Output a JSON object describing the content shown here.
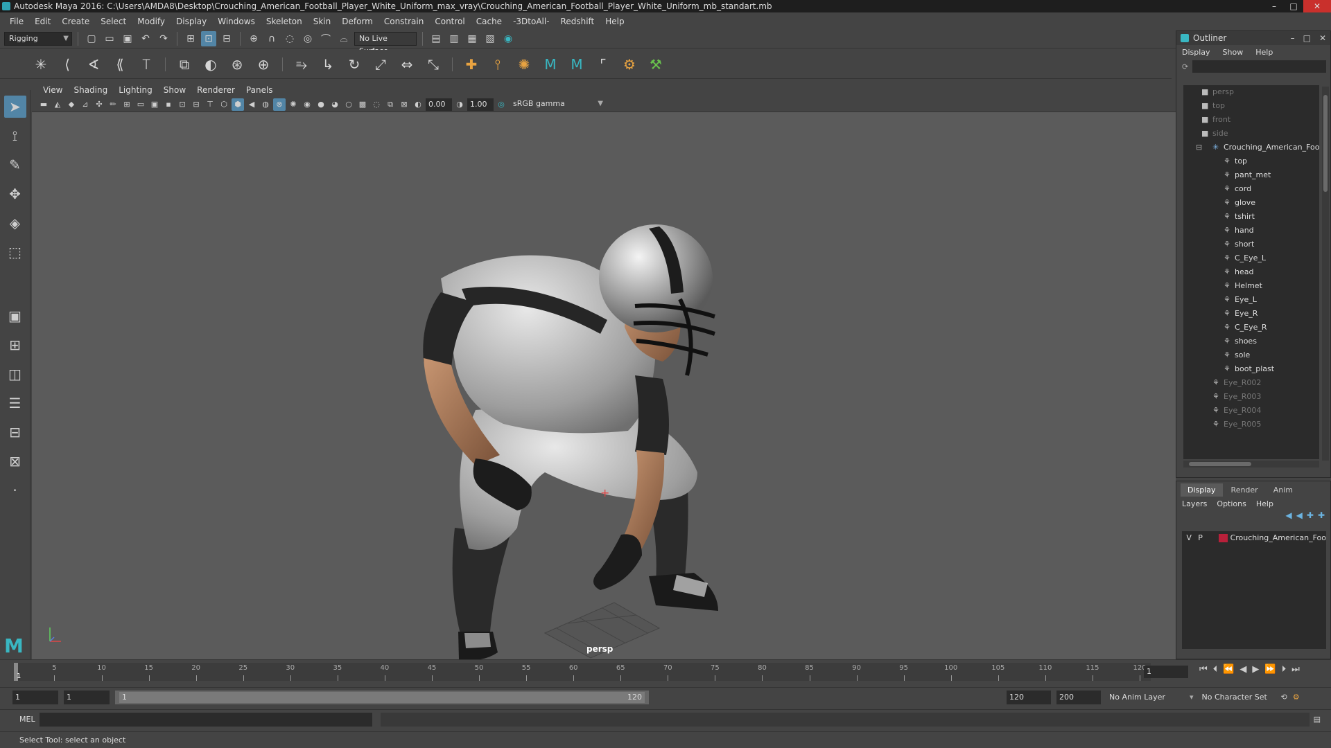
{
  "window": {
    "title": "Autodesk Maya 2016: C:\\Users\\AMDA8\\Desktop\\Crouching_American_Football_Player_White_Uniform_max_vray\\Crouching_American_Football_Player_White_Uniform_mb_standart.mb",
    "controls": {
      "minimize": "–",
      "maximize": "□",
      "close": "✕"
    }
  },
  "menubar": [
    "File",
    "Edit",
    "Create",
    "Select",
    "Modify",
    "Display",
    "Windows",
    "Skeleton",
    "Skin",
    "Deform",
    "Constrain",
    "Control",
    "Cache",
    "-3DtoAll-",
    "Redshift",
    "Help"
  ],
  "statusline": {
    "mode": "Rigging",
    "live_surface": "No Live Surface"
  },
  "viewport": {
    "menu": [
      "View",
      "Shading",
      "Lighting",
      "Show",
      "Renderer",
      "Panels"
    ],
    "exposure": "0.00",
    "gamma": "1.00",
    "color_space": "sRGB gamma",
    "camera_label": "persp"
  },
  "outliner": {
    "title": "Outliner",
    "title_buttons": {
      "minimize": "–",
      "maximize": "□",
      "close": "✕"
    },
    "menu": [
      "Display",
      "Show",
      "Help"
    ],
    "items": [
      {
        "label": "persp",
        "type": "camera",
        "dim": true
      },
      {
        "label": "top",
        "type": "camera",
        "dim": true
      },
      {
        "label": "front",
        "type": "camera",
        "dim": true
      },
      {
        "label": "side",
        "type": "camera",
        "dim": true
      },
      {
        "label": "Crouching_American_Foo",
        "type": "group",
        "dim": false
      },
      {
        "label": "top",
        "type": "mesh",
        "dim": false
      },
      {
        "label": "pant_met",
        "type": "mesh",
        "dim": false
      },
      {
        "label": "cord",
        "type": "mesh",
        "dim": false
      },
      {
        "label": "glove",
        "type": "mesh",
        "dim": false
      },
      {
        "label": "tshirt",
        "type": "mesh",
        "dim": false
      },
      {
        "label": "hand",
        "type": "mesh",
        "dim": false
      },
      {
        "label": "short",
        "type": "mesh",
        "dim": false
      },
      {
        "label": "C_Eye_L",
        "type": "mesh",
        "dim": false
      },
      {
        "label": "head",
        "type": "mesh",
        "dim": false
      },
      {
        "label": "Helmet",
        "type": "mesh",
        "dim": false
      },
      {
        "label": "Eye_L",
        "type": "mesh",
        "dim": false
      },
      {
        "label": "Eye_R",
        "type": "mesh",
        "dim": false
      },
      {
        "label": "C_Eye_R",
        "type": "mesh",
        "dim": false
      },
      {
        "label": "shoes",
        "type": "mesh",
        "dim": false
      },
      {
        "label": "sole",
        "type": "mesh",
        "dim": false
      },
      {
        "label": "boot_plast",
        "type": "mesh",
        "dim": false
      },
      {
        "label": "Eye_R002",
        "type": "mesh",
        "dim": true
      },
      {
        "label": "Eye_R003",
        "type": "mesh",
        "dim": true
      },
      {
        "label": "Eye_R004",
        "type": "mesh",
        "dim": true
      },
      {
        "label": "Eye_R005",
        "type": "mesh",
        "dim": true
      }
    ]
  },
  "layers": {
    "tabs": [
      "Display",
      "Render",
      "Anim"
    ],
    "menu": [
      "Layers",
      "Options",
      "Help"
    ],
    "rows": [
      {
        "v": "V",
        "p": "P",
        "name": "Crouching_American_Foo",
        "color": "#b8203a"
      }
    ]
  },
  "timeline": {
    "ticks": [
      1,
      5,
      10,
      15,
      20,
      25,
      30,
      35,
      40,
      45,
      50,
      55,
      60,
      65,
      70,
      75,
      80,
      85,
      90,
      95,
      100,
      105,
      110,
      115,
      120
    ],
    "start_label": "1",
    "current_frame": "1"
  },
  "range": {
    "start": "1",
    "anim_start": "1",
    "range_start": "1",
    "range_end": "120",
    "end": "120",
    "anim_end": "200",
    "anim_layer": "No Anim Layer",
    "character_set": "No Character Set"
  },
  "cmdline": {
    "lang": "MEL"
  },
  "helpline": {
    "text": "Select Tool: select an object"
  }
}
